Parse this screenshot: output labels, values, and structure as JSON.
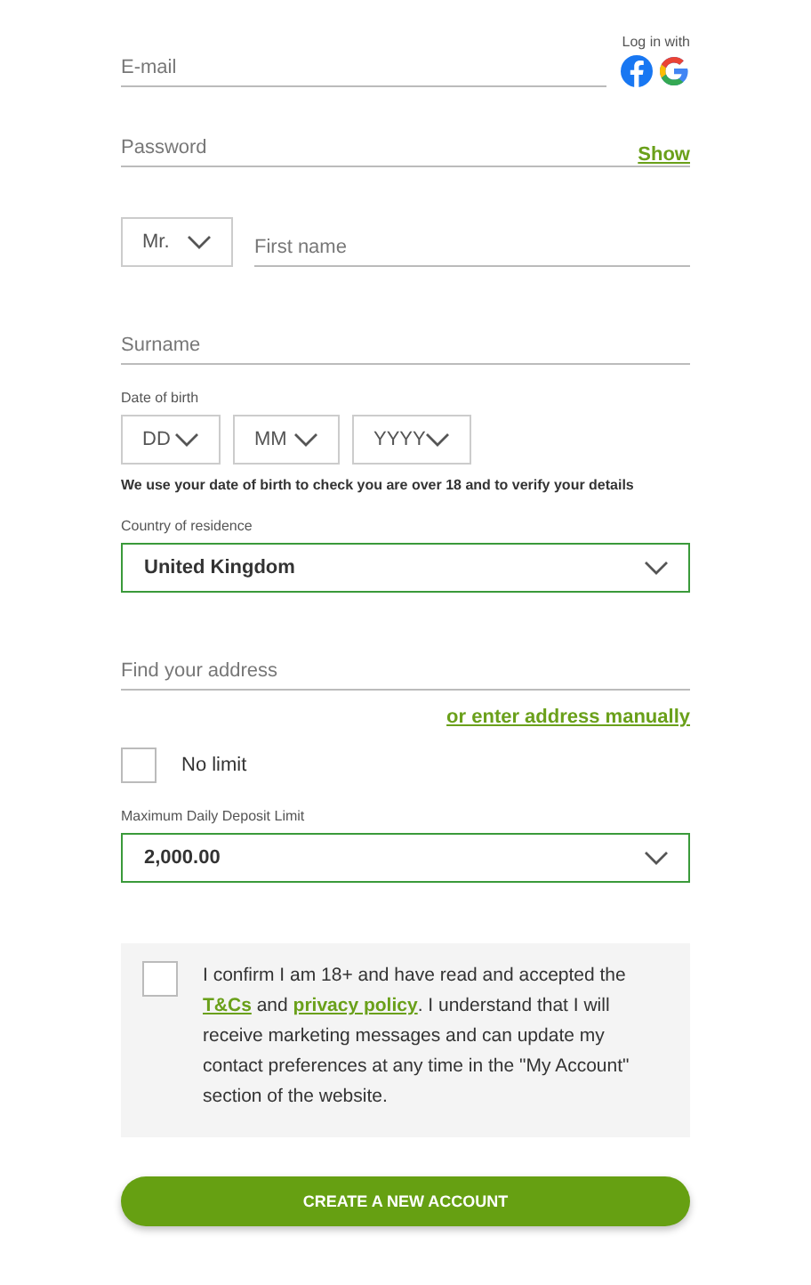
{
  "social_login": {
    "label": "Log in with"
  },
  "email": {
    "placeholder": "E-mail"
  },
  "password": {
    "placeholder": "Password",
    "show_link": "Show"
  },
  "title_select": {
    "value": "Mr."
  },
  "first_name": {
    "placeholder": "First name"
  },
  "surname": {
    "placeholder": "Surname"
  },
  "date_of_birth": {
    "label": "Date of birth",
    "selects": [
      "DD",
      "MM",
      "YYYY"
    ],
    "note": "We use your date of birth to check you are over 18 and to verify your details"
  },
  "country": {
    "label": "Country of residence",
    "value": "United Kingdom"
  },
  "address": {
    "placeholder": "Find your address",
    "manual_link": "or enter address manually"
  },
  "no_limit": {
    "label": "No limit",
    "checked": false
  },
  "deposit_limit": {
    "label": "Maximum Daily Deposit Limit",
    "value": "2,000.00"
  },
  "consent": {
    "checked": false,
    "parts": [
      {
        "kind": "text",
        "text": "I confirm I am 18+ and have read and accepted the "
      },
      {
        "kind": "link",
        "text": "T&Cs"
      },
      {
        "kind": "text",
        "text": " and "
      },
      {
        "kind": "link",
        "text": "privacy policy"
      },
      {
        "kind": "text",
        "text": ". I understand that I will receive marketing messages and can update my contact preferences at any time in the \"My Account\" section of the website."
      }
    ]
  },
  "submit_button": "CREATE A NEW ACCOUNT"
}
